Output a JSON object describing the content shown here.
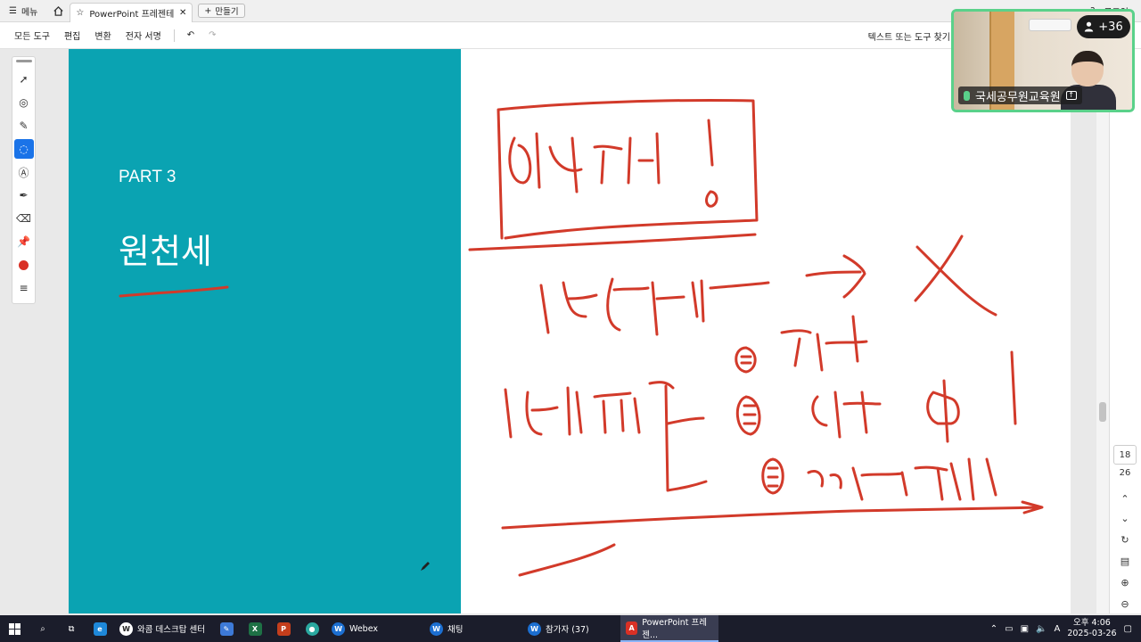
{
  "browser": {
    "menu_label": "메뉴",
    "tab_title": "PowerPoint 프레젠테...",
    "new_tab_label": "만들기",
    "login_label": "로그인"
  },
  "toolbar": {
    "items": [
      "모든 도구",
      "편집",
      "변환",
      "전자 서명"
    ],
    "find_placeholder": "텍스트 또는 도구 찾기"
  },
  "slide": {
    "part_label": "PART 3",
    "title": "원천세"
  },
  "page_nav": {
    "current": "18",
    "total": "26"
  },
  "video": {
    "participant_badge": "+36",
    "name": "국세공무원교육원"
  },
  "taskbar": {
    "apps": [
      {
        "name": "와콤 데스크탑 센터",
        "icon": "wacom-icon",
        "color": "#ffffff"
      },
      {
        "name": "Webex",
        "icon": "webex-icon",
        "color": "#1c6fd1"
      },
      {
        "name": "채팅",
        "icon": "webex-icon",
        "color": "#1c6fd1"
      },
      {
        "name": "참가자 (37)",
        "icon": "webex-icon",
        "color": "#1c6fd1"
      },
      {
        "name": "PowerPoint 프레젠...",
        "icon": "pdf-icon",
        "color": "#d93025"
      }
    ],
    "time": "오후 4:06",
    "date": "2025-03-26",
    "ime": "A"
  },
  "colors": {
    "slide_teal": "#0aa3b2",
    "ink_red": "#d23a2a",
    "active_tool": "#1a73e8"
  }
}
